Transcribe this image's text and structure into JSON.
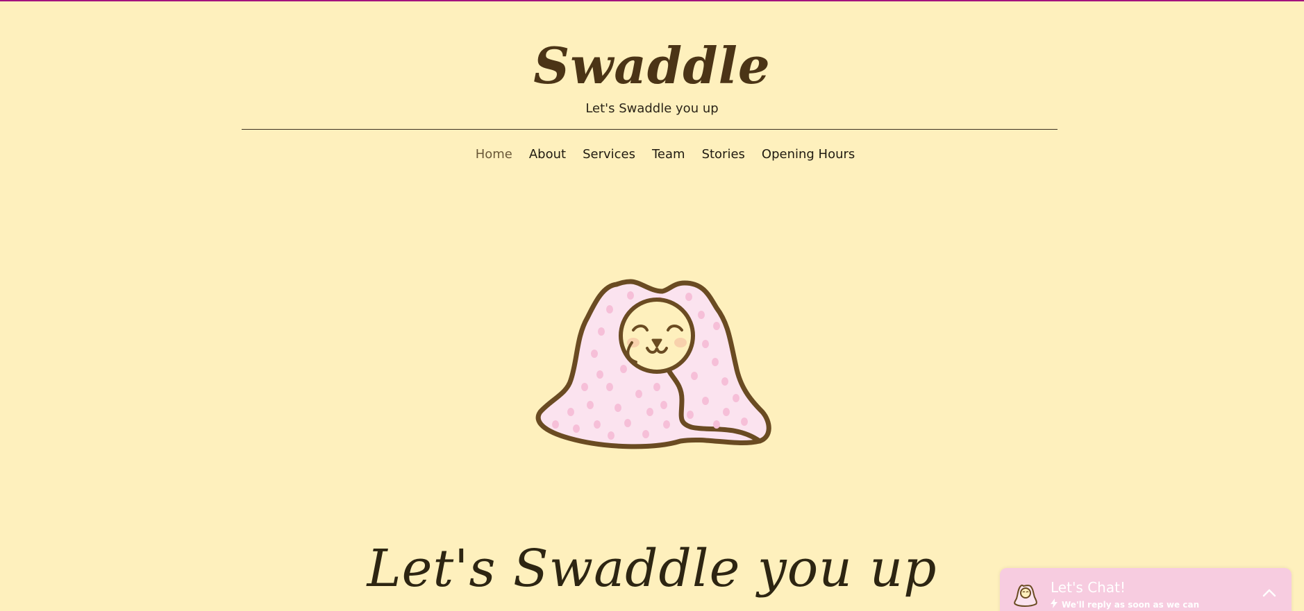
{
  "site": {
    "title": "Swaddle",
    "tagline": "Let's Swaddle you up"
  },
  "nav": {
    "items": [
      {
        "label": "Home",
        "active": true
      },
      {
        "label": "About"
      },
      {
        "label": "Services"
      },
      {
        "label": "Team"
      },
      {
        "label": "Stories"
      },
      {
        "label": "Opening Hours"
      }
    ]
  },
  "hero": {
    "image_icon": "swaddled-baby-illustration",
    "headline": "Let's Swaddle you up"
  },
  "chat": {
    "title": "Let's Chat!",
    "subtitle": "We'll reply as soon as we can",
    "avatar_icon": "swaddled-baby-avatar",
    "subtitle_icon": "lightning-icon",
    "toggle_icon": "chevron-up-icon"
  },
  "colors": {
    "background": "#fef0bd",
    "top_bar": "#a3127e",
    "brand": "#4b3416",
    "chat_bg": "#f7cce0",
    "blanket": "#fbe3ef",
    "blanket_dots": "#f6bfd8"
  }
}
